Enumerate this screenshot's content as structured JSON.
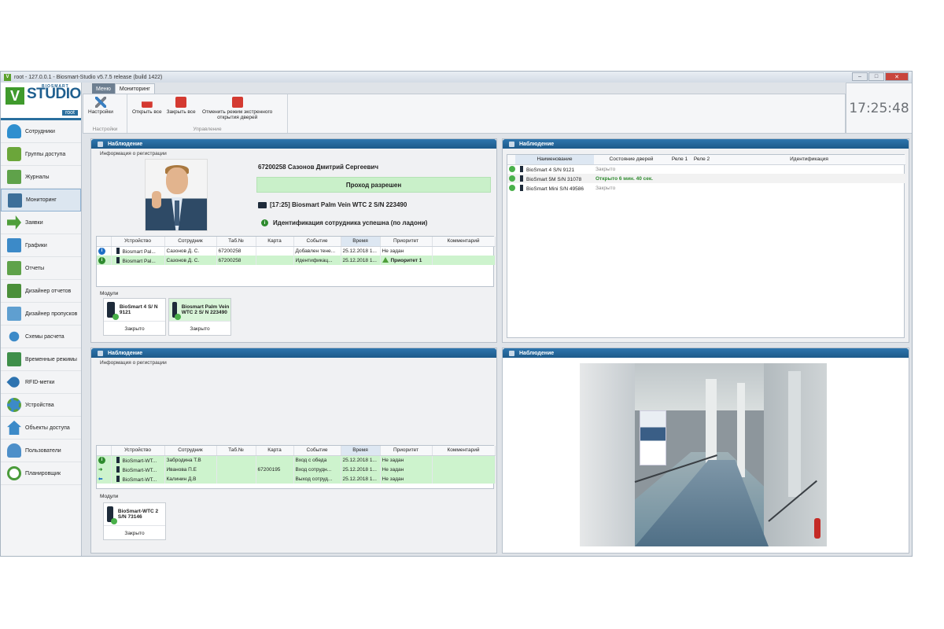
{
  "window": {
    "title": "root - 127.0.0.1 - Biosmart-Studio v5.7.5 release (build 1422)",
    "app_icon": "V",
    "controls": [
      "–",
      "□",
      "✕"
    ]
  },
  "logo": {
    "brand_top": "BIOSMART",
    "brand": "STUDIO",
    "letter": "V",
    "user": "root"
  },
  "sidebar": {
    "items": [
      {
        "label": "Сотрудники",
        "icon": "people-icon"
      },
      {
        "label": "Группы доступа",
        "icon": "key-icon"
      },
      {
        "label": "Журналы",
        "icon": "journal-icon"
      },
      {
        "label": "Мониторинг",
        "icon": "monitor-icon"
      },
      {
        "label": "Заявки",
        "icon": "request-arrow-icon"
      },
      {
        "label": "Графики",
        "icon": "chart-icon"
      },
      {
        "label": "Отчеты",
        "icon": "report-icon"
      },
      {
        "label": "Дизайнер отчетов",
        "icon": "report-designer-icon"
      },
      {
        "label": "Дизайнер пропусков",
        "icon": "pass-designer-icon"
      },
      {
        "label": "Схемы расчета",
        "icon": "scheme-icon"
      },
      {
        "label": "Временные режимы",
        "icon": "time-mode-icon"
      },
      {
        "label": "RFID-метки",
        "icon": "rfid-icon"
      },
      {
        "label": "Устройства",
        "icon": "devices-icon"
      },
      {
        "label": "Объекты доступа",
        "icon": "access-object-icon"
      },
      {
        "label": "Пользователи",
        "icon": "users-icon"
      },
      {
        "label": "Планировщик",
        "icon": "scheduler-icon"
      }
    ]
  },
  "ribbon": {
    "tabs": [
      "Меню",
      "Мониторинг"
    ],
    "groups": [
      {
        "title": "Настройки",
        "buttons": [
          {
            "label": "Настройки"
          }
        ]
      },
      {
        "title": "Управление",
        "buttons": [
          {
            "label": "Открыть все"
          },
          {
            "label": "Закрыть все"
          },
          {
            "label": "Отменить режим экстренного открытия дверей"
          }
        ]
      }
    ]
  },
  "clock": "17:25:48",
  "panel1": {
    "title": "Наблюдение",
    "reg_label": "Информация о регистрации",
    "person": "67200258 Сазонов Дмитрий Сергеевич",
    "pass_status": "Проход разрешен",
    "device": "[17:25] Biosmart Palm Vein WTC 2 S/N 223490",
    "identification": "Идентификация сотрудника успешна (по ладони)",
    "columns": [
      "Устройство",
      "Сотрудник",
      "Таб.№",
      "Карта",
      "Событие",
      "Время",
      "Приоритет",
      "Комментарий"
    ],
    "rows": [
      {
        "device": "Biosmart Pal...",
        "employee": "Сазонов Д. С.",
        "tab": "67200258",
        "card": "",
        "event": "Добавлен тене...",
        "time": "25.12.2018 1...",
        "priority": "Не задан",
        "comment": ""
      },
      {
        "device": "Biosmart Pal...",
        "employee": "Сазонов Д. С.",
        "tab": "67200258",
        "card": "",
        "event": "Идентификац...",
        "time": "25.12.2018 1...",
        "priority": "Приоритет 1",
        "comment": ""
      }
    ],
    "modules_label": "Модули",
    "modules": [
      {
        "name": "BioSmart 4 S/ N 9121",
        "state": "Закрыто"
      },
      {
        "name": "Biosmart Palm Vein WTC 2 S/ N 223490",
        "state": "Закрыто"
      }
    ]
  },
  "panel2": {
    "title": "Наблюдение",
    "columns": [
      "Наименование",
      "Состояние дверей",
      "Реле 1",
      "Реле 2",
      "Идентификация"
    ],
    "rows": [
      {
        "name": "BioSmart 4 S/N 9121",
        "state": "Закрыто"
      },
      {
        "name": "BioSmart 5M S/N 31078",
        "state": "Открыто 6 мин. 40 сек."
      },
      {
        "name": "BioSmart Mini S/N 49586",
        "state": "Закрыто"
      }
    ]
  },
  "panel3": {
    "title": "Наблюдение",
    "reg_label": "Информация о регистрации",
    "columns": [
      "Устройство",
      "Сотрудник",
      "Таб.№",
      "Карта",
      "Событие",
      "Время",
      "Приоритет",
      "Комментарий"
    ],
    "rows": [
      {
        "device": "BioSmart-WT...",
        "employee": "Забродина Т.В",
        "tab": "",
        "card": "",
        "event": "Вход с обеда",
        "time": "25.12.2018 1...",
        "priority": "Не задан",
        "comment": ""
      },
      {
        "device": "BioSmart-WT...",
        "employee": "Иванова П.Е",
        "tab": "",
        "card": "67200195",
        "event": "Вход сотрудн...",
        "time": "25.12.2018 1...",
        "priority": "Не задан",
        "comment": ""
      },
      {
        "device": "BioSmart-WT...",
        "employee": "Калинин Д.В",
        "tab": "",
        "card": "",
        "event": "Выход сотруд...",
        "time": "25.12.2018 1...",
        "priority": "Не задан",
        "comment": ""
      }
    ],
    "modules_label": "Модули",
    "modules": [
      {
        "name": "BioSmart-WTC 2 S/N 73146",
        "state": "Закрыто"
      }
    ]
  },
  "panel4": {
    "title": "Наблюдение"
  }
}
